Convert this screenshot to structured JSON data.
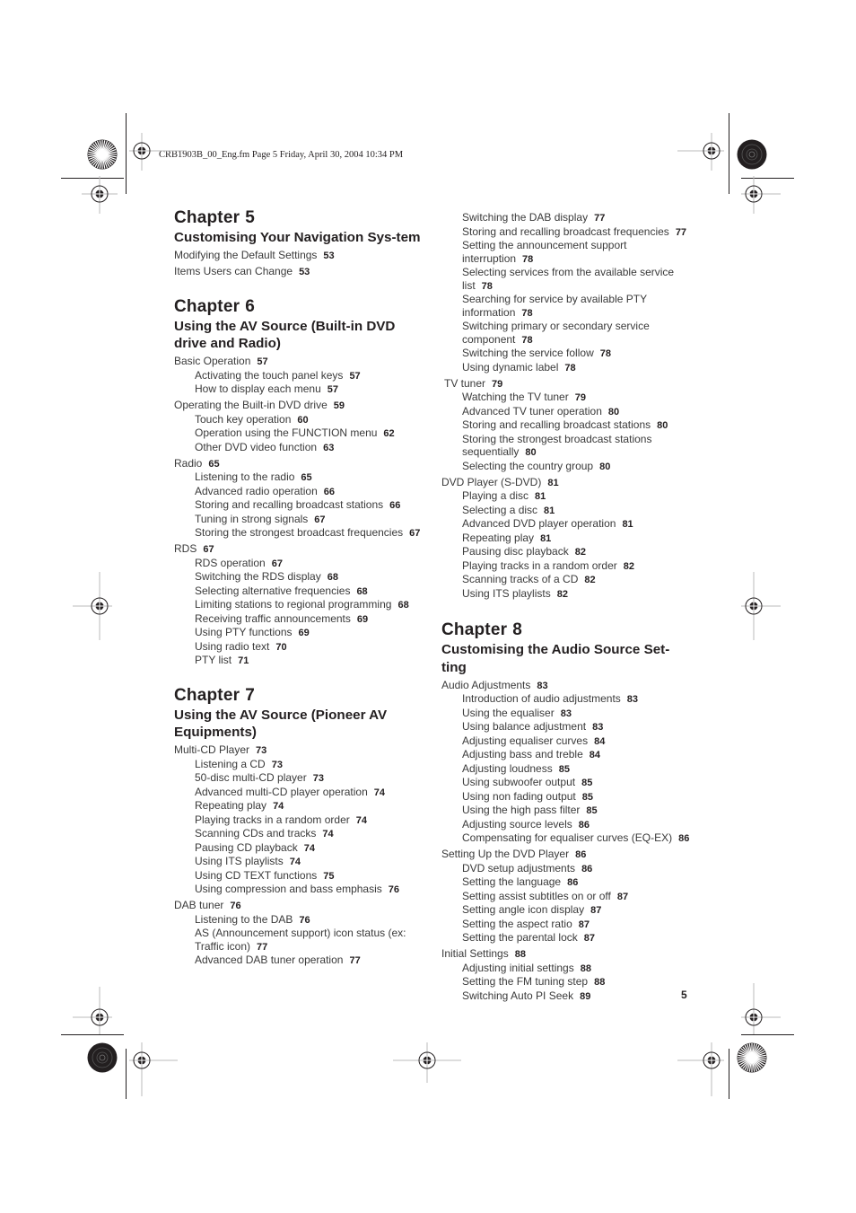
{
  "header": {
    "slug": "CRB1903B_00_Eng.fm  Page 5  Friday, April 30, 2004  10:34 PM"
  },
  "page_number": "5",
  "columns": {
    "left": [
      {
        "chapter_label": "Chapter",
        "chapter_number": "5",
        "title": "Customising Your Navigation Sys-tem",
        "entries": [
          {
            "level": 1,
            "label": "Modifying the Default Settings",
            "page": "53"
          },
          {
            "level": 1,
            "label": "Items Users can Change",
            "page": "53"
          }
        ]
      },
      {
        "chapter_label": "Chapter",
        "chapter_number": "6",
        "title": "Using the AV Source (Built-in DVD drive and Radio)",
        "entries": [
          {
            "level": 1,
            "label": "Basic Operation",
            "page": "57"
          },
          {
            "level": 2,
            "label": "Activating the touch panel keys",
            "page": "57"
          },
          {
            "level": 2,
            "label": "How to display each menu",
            "page": "57"
          },
          {
            "level": 1,
            "label": "Operating the Built-in DVD drive",
            "page": "59"
          },
          {
            "level": 2,
            "label": "Touch key operation",
            "page": "60"
          },
          {
            "level": 2,
            "label": "Operation using the FUNCTION menu",
            "page": "62"
          },
          {
            "level": 2,
            "label": "Other DVD video function",
            "page": "63"
          },
          {
            "level": 1,
            "label": "Radio",
            "page": "65"
          },
          {
            "level": 2,
            "label": "Listening to the radio",
            "page": "65"
          },
          {
            "level": 2,
            "label": "Advanced radio operation",
            "page": "66"
          },
          {
            "level": 2,
            "label": "Storing and recalling broadcast stations",
            "page": "66"
          },
          {
            "level": 2,
            "label": "Tuning in strong signals",
            "page": "67"
          },
          {
            "level": 2,
            "label": "Storing the strongest broadcast frequencies",
            "page": "67"
          },
          {
            "level": 1,
            "label": "RDS",
            "page": "67"
          },
          {
            "level": 2,
            "label": "RDS operation",
            "page": "67"
          },
          {
            "level": 2,
            "label": "Switching the RDS display",
            "page": "68"
          },
          {
            "level": 2,
            "label": "Selecting alternative frequencies",
            "page": "68"
          },
          {
            "level": 2,
            "label": "Limiting stations to regional programming",
            "page": "68"
          },
          {
            "level": 2,
            "label": "Receiving traffic announcements",
            "page": "69"
          },
          {
            "level": 2,
            "label": "Using PTY functions",
            "page": "69"
          },
          {
            "level": 2,
            "label": "Using radio text",
            "page": "70"
          },
          {
            "level": 2,
            "label": "PTY list",
            "page": "71"
          }
        ]
      },
      {
        "chapter_label": "Chapter",
        "chapter_number": "7",
        "title": "Using the AV Source (Pioneer AV Equipments)",
        "entries": [
          {
            "level": 1,
            "label": "Multi-CD Player",
            "page": "73"
          },
          {
            "level": 2,
            "label": "Listening a CD",
            "page": "73"
          },
          {
            "level": 2,
            "label": "50-disc multi-CD player",
            "page": "73"
          },
          {
            "level": 2,
            "label": "Advanced multi-CD player operation",
            "page": "74"
          },
          {
            "level": 2,
            "label": "Repeating play",
            "page": "74"
          },
          {
            "level": 2,
            "label": "Playing tracks in a random order",
            "page": "74"
          },
          {
            "level": 2,
            "label": "Scanning CDs and tracks",
            "page": "74"
          },
          {
            "level": 2,
            "label": "Pausing CD playback",
            "page": "74"
          },
          {
            "level": 2,
            "label": "Using ITS playlists",
            "page": "74"
          },
          {
            "level": 2,
            "label": "Using CD TEXT functions",
            "page": "75"
          },
          {
            "level": 2,
            "label": "Using compression and bass emphasis",
            "page": "76"
          },
          {
            "level": 1,
            "label": "DAB tuner",
            "page": "76"
          },
          {
            "level": 2,
            "label": "Listening to the DAB",
            "page": "76"
          },
          {
            "level": 2,
            "label": "AS (Announcement support) icon status (ex: Traffic icon)",
            "page": "77"
          },
          {
            "level": 2,
            "label": "Advanced DAB tuner operation",
            "page": "77"
          }
        ]
      }
    ],
    "right": [
      {
        "chapter_label": null,
        "entries": [
          {
            "level": 2,
            "label": "Switching the DAB display",
            "page": "77"
          },
          {
            "level": 2,
            "label": "Storing and recalling broadcast frequencies",
            "page": "77"
          },
          {
            "level": 2,
            "label": "Setting the announcement support interruption",
            "page": "78"
          },
          {
            "level": 2,
            "label": "Selecting services from the available service list",
            "page": "78"
          },
          {
            "level": 2,
            "label": "Searching for service by available PTY information",
            "page": "78"
          },
          {
            "level": 2,
            "label": "Switching primary or secondary service component",
            "page": "78"
          },
          {
            "level": 2,
            "label": "Switching the service follow",
            "page": "78"
          },
          {
            "level": 2,
            "label": "Using dynamic label",
            "page": "78"
          },
          {
            "level": 1,
            "label": "TV tuner",
            "page": "79"
          },
          {
            "level": 2,
            "label": "Watching the TV tuner",
            "page": "79"
          },
          {
            "level": 2,
            "label": "Advanced TV tuner operation",
            "page": "80"
          },
          {
            "level": 2,
            "label": "Storing and recalling broadcast stations",
            "page": "80"
          },
          {
            "level": 2,
            "label": "Storing the strongest broadcast stations sequentially",
            "page": "80"
          },
          {
            "level": 2,
            "label": "Selecting the country group",
            "page": "80"
          },
          {
            "level": 1,
            "label": "DVD Player (S-DVD)",
            "page": "81"
          },
          {
            "level": 2,
            "label": "Playing a disc",
            "page": "81"
          },
          {
            "level": 2,
            "label": "Selecting a disc",
            "page": "81"
          },
          {
            "level": 2,
            "label": "Advanced DVD player operation",
            "page": "81"
          },
          {
            "level": 2,
            "label": "Repeating play",
            "page": "81"
          },
          {
            "level": 2,
            "label": "Pausing disc playback",
            "page": "82"
          },
          {
            "level": 2,
            "label": "Playing tracks in a random order",
            "page": "82"
          },
          {
            "level": 2,
            "label": "Scanning tracks of a CD",
            "page": "82"
          },
          {
            "level": 2,
            "label": "Using ITS playlists",
            "page": "82"
          }
        ]
      },
      {
        "chapter_label": "Chapter",
        "chapter_number": "8",
        "title": "Customising the Audio Source Set-ting",
        "entries": [
          {
            "level": 1,
            "label": "Audio Adjustments",
            "page": "83"
          },
          {
            "level": 2,
            "label": "Introduction of audio adjustments",
            "page": "83"
          },
          {
            "level": 2,
            "label": "Using the equaliser",
            "page": "83"
          },
          {
            "level": 2,
            "label": "Using balance adjustment",
            "page": "83"
          },
          {
            "level": 2,
            "label": "Adjusting equaliser curves",
            "page": "84"
          },
          {
            "level": 2,
            "label": "Adjusting bass and treble",
            "page": "84"
          },
          {
            "level": 2,
            "label": "Adjusting loudness",
            "page": "85"
          },
          {
            "level": 2,
            "label": "Using subwoofer output",
            "page": "85"
          },
          {
            "level": 2,
            "label": "Using non fading output",
            "page": "85"
          },
          {
            "level": 2,
            "label": "Using the high pass filter",
            "page": "85"
          },
          {
            "level": 2,
            "label": "Adjusting source levels",
            "page": "86"
          },
          {
            "level": 2,
            "label": "Compensating for equaliser curves (EQ-EX)",
            "page": "86"
          },
          {
            "level": 1,
            "label": "Setting Up the DVD Player",
            "page": "86"
          },
          {
            "level": 2,
            "label": "DVD setup adjustments",
            "page": "86"
          },
          {
            "level": 2,
            "label": "Setting the language",
            "page": "86"
          },
          {
            "level": 2,
            "label": "Setting assist subtitles on or off",
            "page": "87"
          },
          {
            "level": 2,
            "label": "Setting angle icon display",
            "page": "87"
          },
          {
            "level": 2,
            "label": "Setting the aspect ratio",
            "page": "87"
          },
          {
            "level": 2,
            "label": "Setting the parental lock",
            "page": "87"
          },
          {
            "level": 1,
            "label": "Initial Settings",
            "page": "88"
          },
          {
            "level": 2,
            "label": "Adjusting initial settings",
            "page": "88"
          },
          {
            "level": 2,
            "label": "Setting the FM tuning step",
            "page": "88"
          },
          {
            "level": 2,
            "label": "Switching Auto PI Seek",
            "page": "89"
          }
        ]
      }
    ]
  },
  "marks": {
    "registration_icon": "crosshair-registration-icon",
    "color_dial_icon": "color-bar-dial-icon"
  }
}
